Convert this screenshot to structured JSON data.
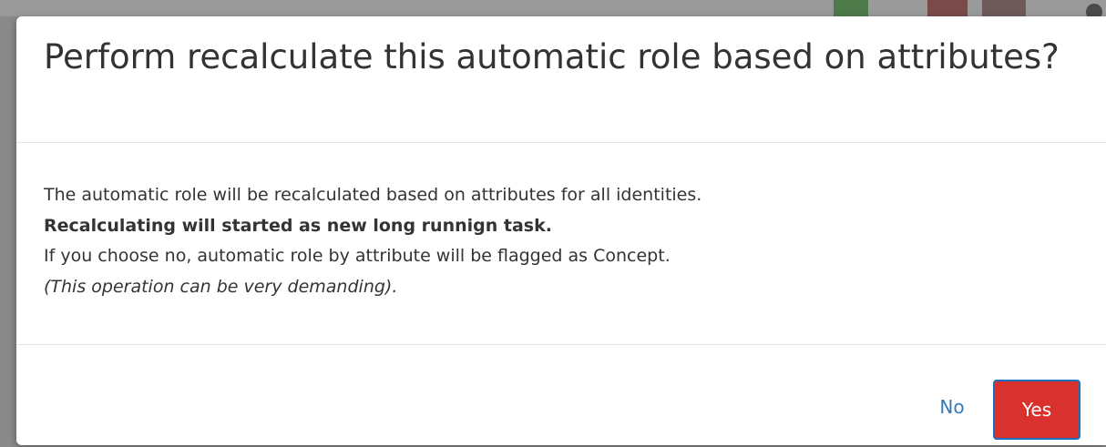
{
  "dialog": {
    "title": "Perform recalculate this automatic role based on attributes?",
    "body": {
      "line1": "The automatic role will be recalculated based on attributes for all identities.",
      "line2": "Recalculating will started as new long runnign task.",
      "line3": "If you choose no, automatic role by attribute will be flagged as Concept.",
      "line4": "(This operation can be very demanding)."
    },
    "buttons": {
      "no_label": "No",
      "yes_label": "Yes"
    }
  },
  "colors": {
    "link": "#337ab7",
    "danger": "#d9312d",
    "focus_outline": "#1a6fbf",
    "text": "#333333",
    "backdrop": "#8a8a8a"
  }
}
